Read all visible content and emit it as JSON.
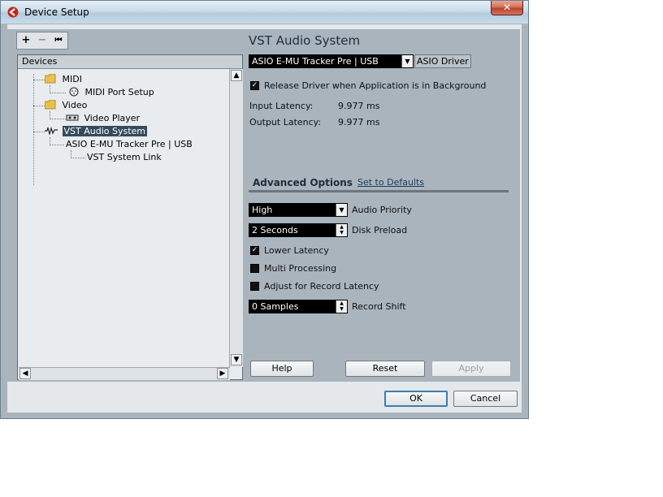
{
  "window": {
    "title": "Device Setup",
    "close_symbol": "✕"
  },
  "toolbar": {
    "add_symbol": "+",
    "remove_symbol": "−",
    "reset_symbol": "⏮"
  },
  "tree": {
    "header": "Devices",
    "items": [
      {
        "label": "MIDI",
        "icon": "folder-icon"
      },
      {
        "label": "MIDI Port Setup",
        "icon": "midi-port-icon"
      },
      {
        "label": "Video",
        "icon": "folder-icon"
      },
      {
        "label": "Video Player",
        "icon": "video-player-icon"
      },
      {
        "label": "VST Audio System",
        "icon": "audio-system-icon",
        "selected": true
      },
      {
        "label": "ASIO E-MU Tracker Pre | USB"
      },
      {
        "label": "VST System Link"
      }
    ]
  },
  "panel": {
    "title": "VST Audio System",
    "driver_select": "ASIO E-MU Tracker Pre | USB",
    "driver_button": "ASIO Driver",
    "release_driver": {
      "label": "Release Driver when Application is in Background",
      "checked": true
    },
    "input_latency": {
      "label": "Input Latency:",
      "value": "9.977 ms"
    },
    "output_latency": {
      "label": "Output Latency:",
      "value": "9.977 ms"
    },
    "advanced_title": "Advanced Options",
    "set_defaults": "Set to Defaults",
    "audio_priority": {
      "value": "High",
      "label": "Audio Priority"
    },
    "disk_preload": {
      "value": "2 Seconds",
      "label": "Disk Preload"
    },
    "lower_latency": {
      "label": "Lower Latency",
      "checked": true
    },
    "multi_processing": {
      "label": "Multi Processing",
      "checked": false
    },
    "adjust_record": {
      "label": "Adjust for Record Latency",
      "checked": false
    },
    "record_shift": {
      "value": "0 Samples",
      "label": "Record Shift"
    },
    "help_button": "Help",
    "reset_button": "Reset",
    "apply_button": "Apply"
  },
  "footer": {
    "ok_button": "OK",
    "cancel_button": "Cancel"
  },
  "colors": {
    "window_bg": "#a9b4bd",
    "selection": "#354a5c",
    "dropdown_bg": "#000000"
  }
}
